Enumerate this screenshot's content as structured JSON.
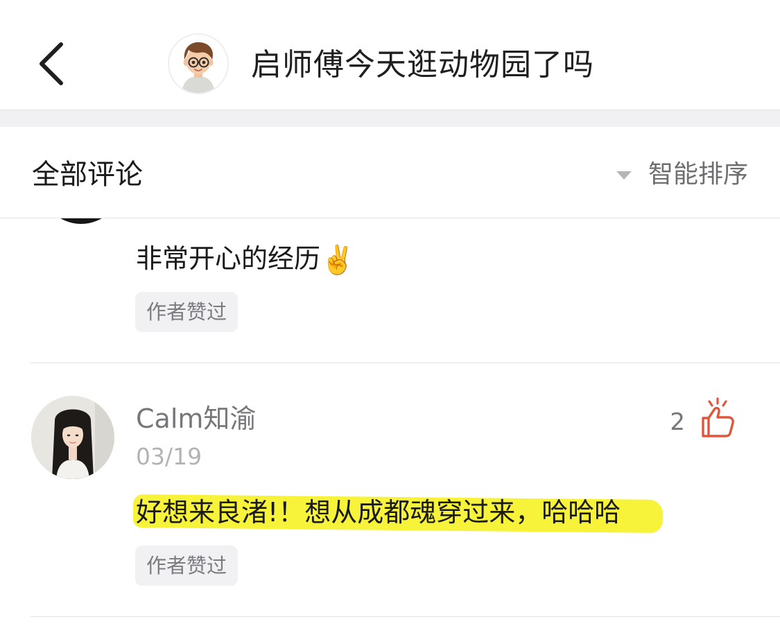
{
  "header": {
    "title": "启师傅今天逛动物园了吗",
    "back_icon": "chevron-left-icon",
    "avatar": "cartoon-avatar-glasses"
  },
  "comments_section": {
    "title": "全部评论",
    "sort_label": "智能排序",
    "sort_icon": "triangle-down-icon"
  },
  "comments": [
    {
      "text": "非常开心的经历",
      "emoji": "✌️",
      "author_liked_tag": "作者赞过"
    },
    {
      "username": "Calm知渝",
      "date": "03/19",
      "likes": "2",
      "text": "好想来良渚!！想从成都魂穿过来，哈哈哈",
      "author_liked_tag": "作者赞过",
      "highlight_color": "#f7f33a",
      "like_icon_color": "#e0563b"
    }
  ]
}
